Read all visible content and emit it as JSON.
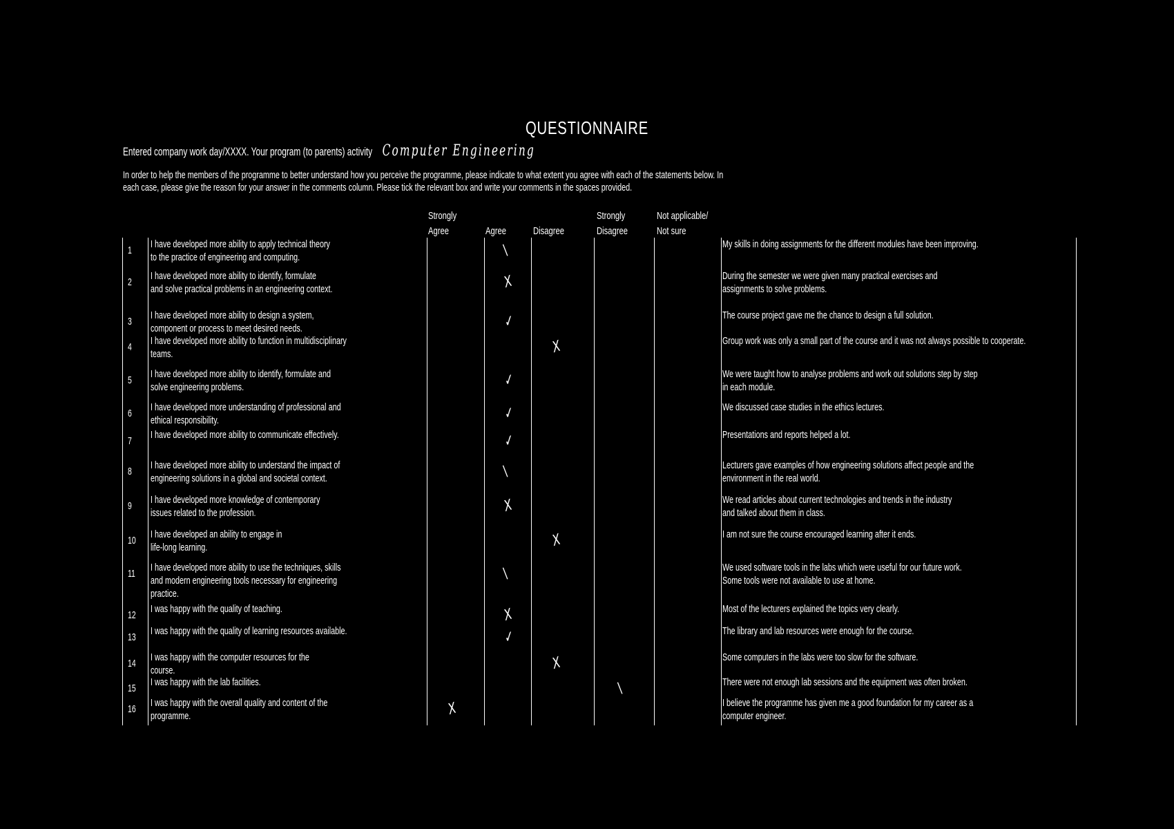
{
  "document": {
    "title": "QUESTIONNAIRE",
    "intro": "Entered company work day/XXXX. Your program (to parents) activity",
    "handwritten_entry": "Computer Engineering",
    "instructions": [
      "In order to help the members of the programme to better understand how you perceive the programme, please indicate to what extent you agree with each of the statements below. In",
      "each case, please give the reason for your answer in the comments column. Please tick the relevant box and write your comments in the spaces provided."
    ]
  },
  "columns": {
    "strongly_agree": [
      "Strongly",
      "Agree"
    ],
    "agree": [
      "Agree"
    ],
    "disagree": [
      "Disagree"
    ],
    "strongly_disagree": [
      "Strongly",
      "Disagree"
    ],
    "not_applicable": [
      "Not applicable/",
      "Not sure"
    ]
  },
  "rows": [
    {
      "num": "1",
      "statement": [
        "I have developed more ability to apply technical theory",
        "to the practice of engineering and computing."
      ],
      "mark": "\\",
      "mark_col": "agree",
      "comment": [
        "My skills in doing assignments for the different modules have been improving."
      ]
    },
    {
      "num": "2",
      "statement": [
        "I have developed more ability to identify, formulate",
        "and solve practical problems in an engineering context."
      ],
      "mark": "X",
      "mark_col": "agree",
      "comment": [
        "During the semester we were given many practical exercises and",
        "assignments to solve problems."
      ]
    },
    {
      "num": "3",
      "statement": [
        "I have developed more ability to design a system,",
        "component or process to meet desired needs."
      ],
      "mark": "✓",
      "mark_col": "agree",
      "comment": [
        "The course project gave me the chance to design a full solution."
      ]
    },
    {
      "num": "4",
      "statement": [
        "I have developed more ability to function in multidisciplinary",
        "teams."
      ],
      "mark": "X",
      "mark_col": "disagree",
      "comment": [
        "Group work was only a small part of the course and it was not always possible to cooperate."
      ]
    },
    {
      "num": "5",
      "statement": [
        "I have developed more ability to identify, formulate and",
        "solve engineering problems."
      ],
      "mark": "✓",
      "mark_col": "agree",
      "comment": [
        "We were taught how to analyse problems and work out solutions step by step",
        "in each module."
      ]
    },
    {
      "num": "6",
      "statement": [
        "I have developed more understanding of professional and",
        "ethical responsibility."
      ],
      "mark": "✓",
      "mark_col": "agree",
      "comment": [
        "We discussed case studies in the ethics lectures."
      ]
    },
    {
      "num": "7",
      "statement": [
        "I have developed more ability to communicate effectively."
      ],
      "mark": "✓",
      "mark_col": "agree",
      "comment": [
        "Presentations and reports helped a lot."
      ]
    },
    {
      "num": "8",
      "statement": [
        "I have developed more ability to understand the impact of",
        "engineering solutions in a global and societal context."
      ],
      "mark": "\\",
      "mark_col": "agree",
      "comment": [
        "Lecturers gave examples of how engineering solutions affect people and the",
        "environment in the real world."
      ]
    },
    {
      "num": "9",
      "statement": [
        "I have developed more knowledge of contemporary",
        "issues related to the profession."
      ],
      "mark": "X",
      "mark_col": "agree",
      "comment": [
        "We read articles about current technologies and trends in the industry",
        "and talked about them in class."
      ]
    },
    {
      "num": "10",
      "statement": [
        "I have developed an ability to engage in",
        "life-long learning."
      ],
      "mark": "X",
      "mark_col": "disagree",
      "comment": [
        "I am not sure the course encouraged learning after it ends."
      ]
    },
    {
      "num": "11",
      "statement": [
        "I have developed more ability to use the techniques, skills",
        "and modern engineering tools necessary for engineering",
        "practice."
      ],
      "mark": "\\",
      "mark_col": "agree",
      "comment": [
        "We used software tools in the labs which were useful for our future work.",
        "",
        "Some tools were not available to use at home."
      ]
    },
    {
      "num": "12",
      "statement": [
        "I was happy with the quality of teaching."
      ],
      "mark": "X",
      "mark_col": "agree",
      "comment": [
        "Most of the lecturers explained the topics very clearly."
      ]
    },
    {
      "num": "13",
      "statement": [
        "I was happy with the quality of learning resources available."
      ],
      "mark": "✓",
      "mark_col": "agree",
      "comment": [
        "The library and lab resources were enough for the course."
      ]
    },
    {
      "num": "14",
      "statement": [
        "I was happy with the computer resources for the",
        "course."
      ],
      "mark": "X",
      "mark_col": "disagree",
      "comment": [
        "Some computers in the labs were too slow for the software."
      ]
    },
    {
      "num": "15",
      "statement": [
        "I was happy with the lab facilities."
      ],
      "mark": "\\",
      "mark_col": "strongly_disagree",
      "comment": [
        "There were not enough lab sessions and the equipment was often broken."
      ]
    },
    {
      "num": "16",
      "statement": [
        "I was happy with the overall quality and content of the",
        "programme."
      ],
      "mark": "X",
      "mark_col": "strongly_agree",
      "comment": [
        "I believe the programme has given me a good foundation for my career as a",
        "computer engineer."
      ]
    }
  ]
}
